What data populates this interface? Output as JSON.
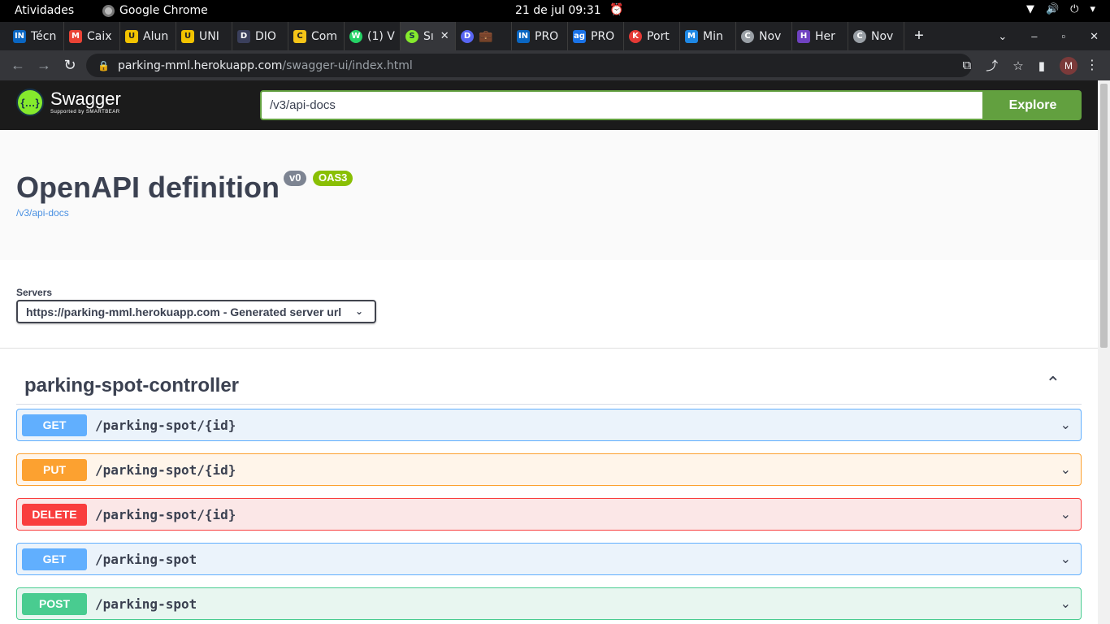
{
  "system_bar": {
    "activities": "Atividades",
    "app_name": "Google Chrome",
    "clock": "21 de jul  09:31"
  },
  "browser": {
    "tabs": [
      {
        "label": "Técn",
        "favicon": "IN",
        "color": "#0a66c2"
      },
      {
        "label": "Caix",
        "favicon": "M",
        "color": "#ea4335"
      },
      {
        "label": "Alun",
        "favicon": "U",
        "color": "#f2c300"
      },
      {
        "label": "UNI",
        "favicon": "U",
        "color": "#f2c300"
      },
      {
        "label": "DIO",
        "favicon": "D",
        "color": "#3a3f5c"
      },
      {
        "label": "Com",
        "favicon": "C",
        "color": "#f5c518"
      },
      {
        "label": "(1) V",
        "favicon": "W",
        "color": "#25d366"
      },
      {
        "label": "Sı",
        "favicon": "S",
        "color": "#85ea2d",
        "active": true
      },
      {
        "label": "",
        "favicon": "D",
        "color": "#5865f2"
      },
      {
        "label": "PRO",
        "favicon": "IN",
        "color": "#0a66c2"
      },
      {
        "label": "PRO",
        "favicon": "ag",
        "color": "#1a73e8"
      },
      {
        "label": "Port",
        "favicon": "K",
        "color": "#e53935"
      },
      {
        "label": "Min",
        "favicon": "M",
        "color": "#1e88e5"
      },
      {
        "label": "Nov",
        "favicon": "C",
        "color": "#9aa0a6"
      },
      {
        "label": "Her",
        "favicon": "H",
        "color": "#6f42c1"
      },
      {
        "label": "Nov",
        "favicon": "C",
        "color": "#9aa0a6"
      }
    ],
    "url_host": "parking-mml.herokuapp.com",
    "url_path": "/swagger-ui/index.html",
    "avatar_letter": "M"
  },
  "swagger": {
    "brand": "Swagger",
    "brand_sub": "Supported by SMARTBEAR",
    "search_value": "/v3/api-docs",
    "explore_label": "Explore",
    "title": "OpenAPI definition",
    "version_badge": "v0",
    "oas_badge": "OAS3",
    "spec_url": "/v3/api-docs",
    "servers_label": "Servers",
    "server_value": "https://parking-mml.herokuapp.com - Generated server url",
    "tag": "parking-spot-controller",
    "operations": [
      {
        "method": "GET",
        "path": "/parking-spot/{id}"
      },
      {
        "method": "PUT",
        "path": "/parking-spot/{id}"
      },
      {
        "method": "DELETE",
        "path": "/parking-spot/{id}"
      },
      {
        "method": "GET",
        "path": "/parking-spot"
      },
      {
        "method": "POST",
        "path": "/parking-spot"
      }
    ]
  }
}
